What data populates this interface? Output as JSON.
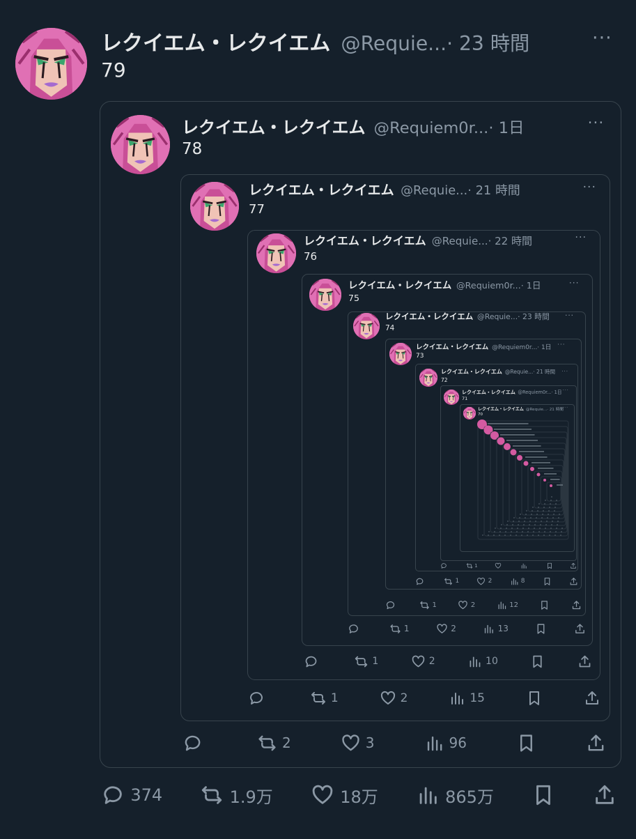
{
  "tweets": [
    {
      "name": "レクイエム・レクイエム",
      "handle": "@Requie...",
      "time": "· 23 時間",
      "text": "79"
    },
    {
      "name": "レクイエム・レクイエム",
      "handle": "@Requiem0r...",
      "time": "· 1日",
      "text": "78"
    },
    {
      "name": "レクイエム・レクイエム",
      "handle": "@Requie...",
      "time": "· 21 時間",
      "text": "77"
    },
    {
      "name": "レクイエム・レクイエム",
      "handle": "@Requie...",
      "time": "· 22 時間",
      "text": "76"
    },
    {
      "name": "レクイエム・レクイエム",
      "handle": "@Requiem0r...",
      "time": "· 1日",
      "text": "75"
    },
    {
      "name": "レクイエム・レクイエム",
      "handle": "@Requie...",
      "time": "· 23 時間",
      "text": "74"
    },
    {
      "name": "レクイエム・レクイエム",
      "handle": "@Requiem0r...",
      "time": "· 1日",
      "text": "73"
    },
    {
      "name": "レクイエム・レクイエム",
      "handle": "@Requie...",
      "time": "· 21 時間",
      "text": "72"
    },
    {
      "name": "レクイエム・レクイエム",
      "handle": "@Requiem0r...",
      "time": "· 1日",
      "text": "71"
    },
    {
      "name": "レクイエム・レクイエム",
      "handle": "@Requie...",
      "time": "· 21 時間",
      "text": "70"
    }
  ],
  "more_icon": "···",
  "action_bars": [
    {
      "reply": "374",
      "retweet": "1.9万",
      "like": "18万",
      "views": "865万"
    },
    {
      "reply": "",
      "retweet": "2",
      "like": "3",
      "views": "96"
    },
    {
      "reply": "",
      "retweet": "1",
      "like": "2",
      "views": "15"
    },
    {
      "reply": "",
      "retweet": "1",
      "like": "2",
      "views": "10"
    },
    {
      "reply": "",
      "retweet": "1",
      "like": "2",
      "views": "13"
    },
    {
      "reply": "",
      "retweet": "1",
      "like": "2",
      "views": "12"
    },
    {
      "reply": "",
      "retweet": "1",
      "like": "2",
      "views": "8"
    },
    {
      "reply": "",
      "retweet": "1",
      "like": "",
      "views": ""
    }
  ],
  "icons": [
    "reply-icon",
    "retweet-icon",
    "like-icon",
    "views-icon",
    "bookmark-icon",
    "share-icon"
  ],
  "colors": {
    "background": "#15202b",
    "border": "#38444d",
    "text": "#e7e9ea",
    "muted": "#8b98a5",
    "avatar_pink": "#d45aa1"
  }
}
